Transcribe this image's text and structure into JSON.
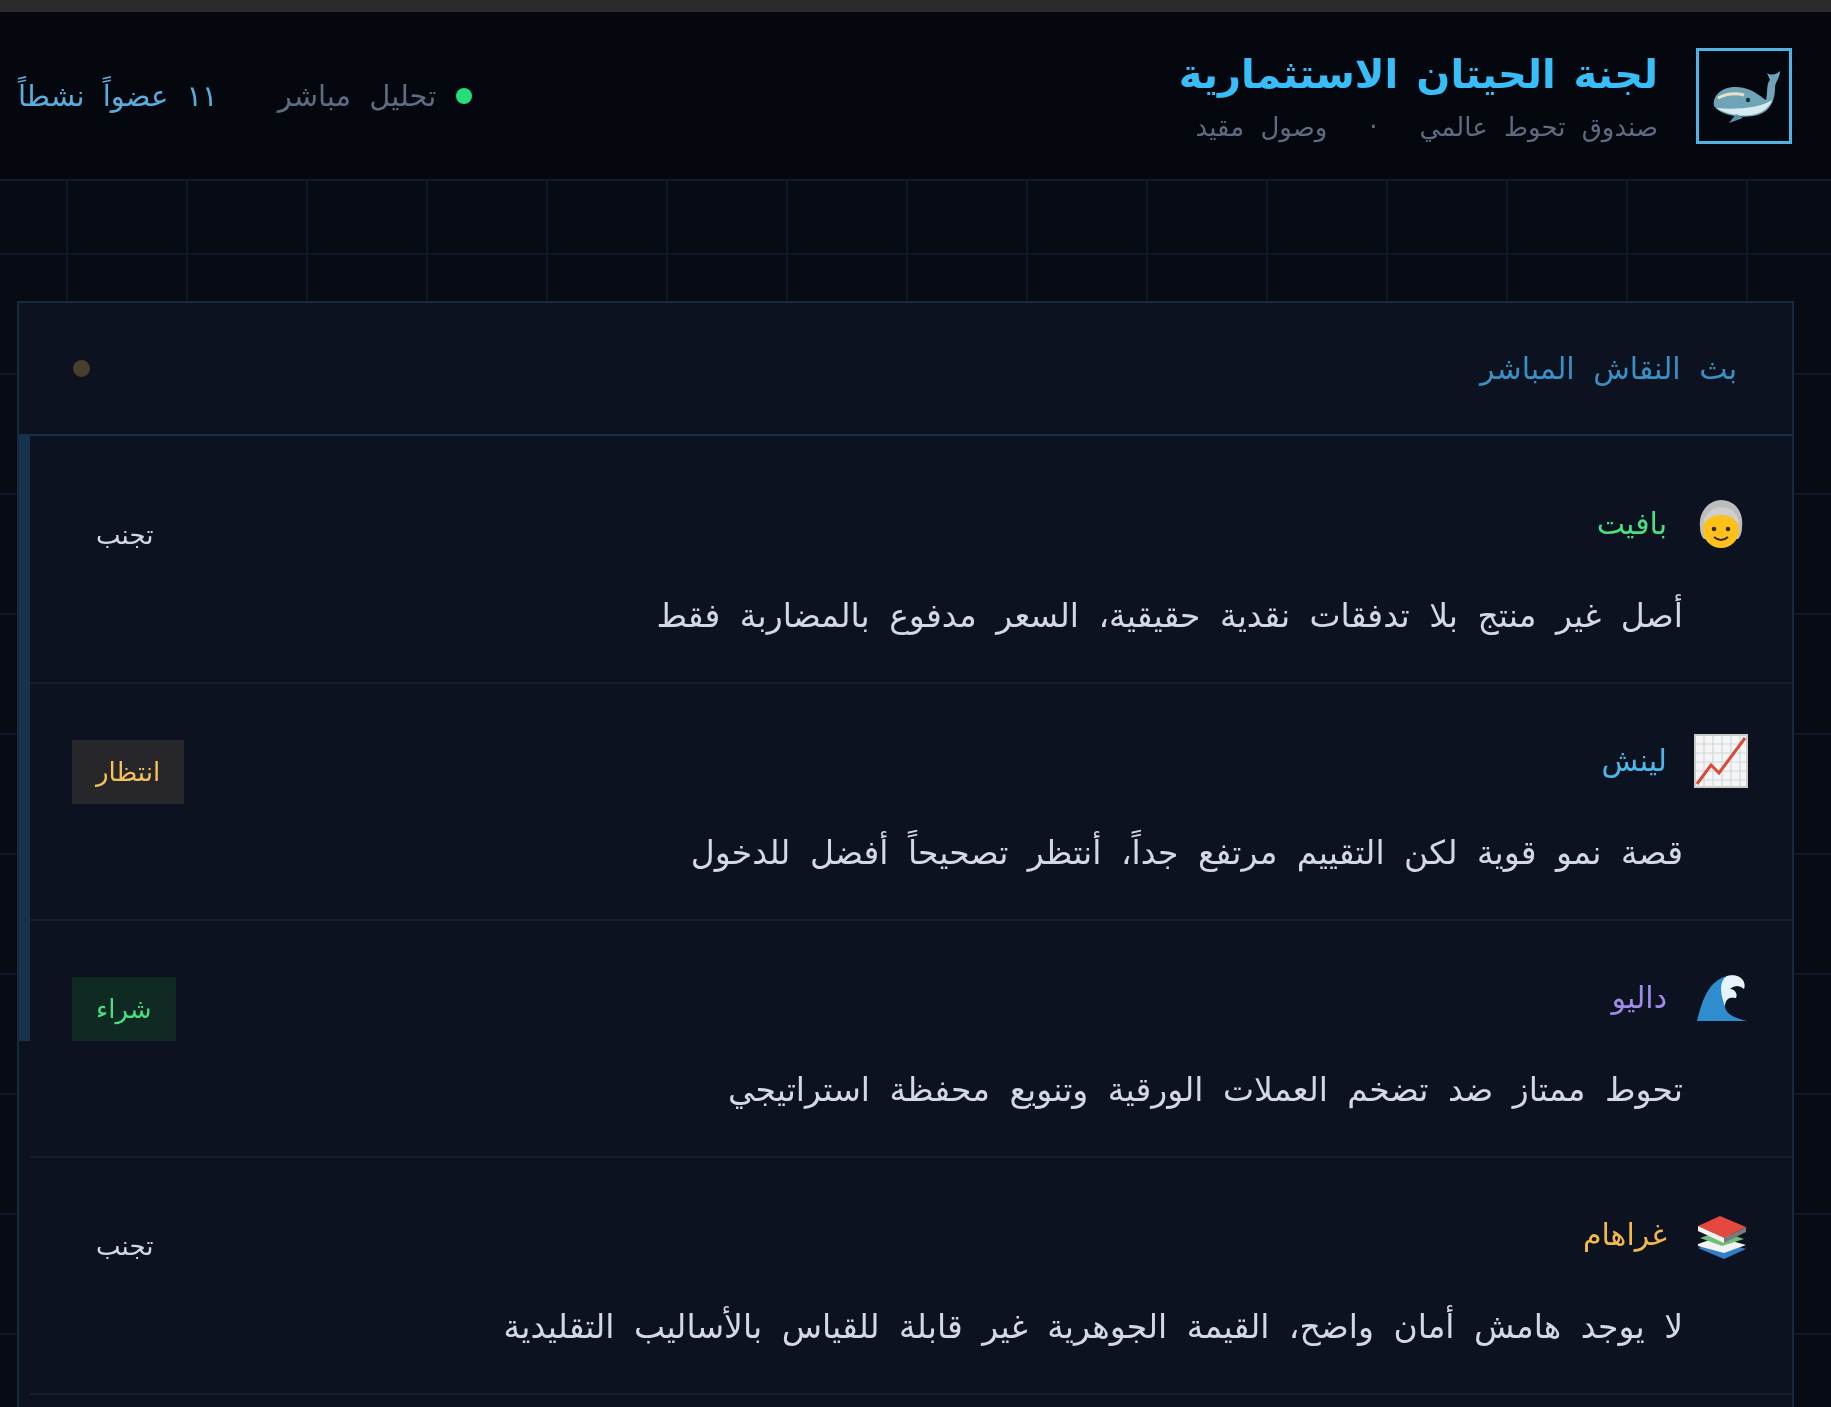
{
  "header": {
    "title": "لجنة الحيتان الاستثمارية",
    "subtitle": {
      "parts": [
        "صندوق تحوط عالمي",
        "وصول مقيد"
      ],
      "separator": "·"
    },
    "status": {
      "live": true,
      "label": "تحليل مباشر"
    },
    "members": "١١ عضواً نشطاً"
  },
  "panel": {
    "title": "بث النقاش المباشر",
    "active": false,
    "messages": [
      {
        "name": "بافيت",
        "color": "#4ade80",
        "text": "أصل غير منتج بلا تدفقات نقدية حقيقية، السعر مدفوع بالمضاربة فقط",
        "verdict": {
          "label": "تجنب",
          "kind": "avoid"
        }
      },
      {
        "name": "لينش",
        "color": "#4cb6e8",
        "text": "قصة نمو قوية لكن التقييم مرتفع جداً، أنتظر تصحيحاً أفضل للدخول",
        "verdict": {
          "label": "انتظار",
          "kind": "wait"
        }
      },
      {
        "name": "داليو",
        "color": "#a08be8",
        "text": "تحوط ممتاز ضد تضخم العملات الورقية وتنويع محفظة استراتيجي",
        "verdict": {
          "label": "شراء",
          "kind": "buy"
        }
      },
      {
        "name": "غراهام",
        "color": "#f3b84a",
        "text": "لا يوجد هامش أمان واضح، القيمة الجوهرية غير قابلة للقياس بالأساليب التقليدية",
        "verdict": {
          "label": "تجنب",
          "kind": "avoid"
        }
      }
    ]
  }
}
